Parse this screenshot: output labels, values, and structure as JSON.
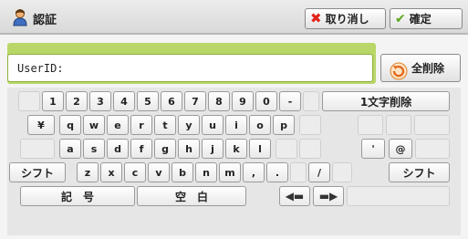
{
  "header": {
    "title": "認証",
    "cancel_label": "取り消し",
    "confirm_label": "確定"
  },
  "input": {
    "value": "UserID:"
  },
  "clear_all_label": "全削除",
  "keys": {
    "r1": [
      "1",
      "2",
      "3",
      "4",
      "5",
      "6",
      "7",
      "8",
      "9",
      "0",
      "-"
    ],
    "delete_one": "1文字削除",
    "r2": [
      "¥",
      "q",
      "w",
      "e",
      "r",
      "t",
      "y",
      "u",
      "i",
      "o",
      "p"
    ],
    "r3": [
      "a",
      "s",
      "d",
      "f",
      "g",
      "h",
      "j",
      "k",
      "l",
      "'",
      "@"
    ],
    "shift": "シフト",
    "r4": [
      "z",
      "x",
      "c",
      "v",
      "b",
      "n",
      "m",
      ",",
      ".",
      "/"
    ],
    "symbols": "記　号",
    "space": "空　白",
    "left_arrow": "◀▬",
    "right_arrow": "▬▶"
  },
  "colors": {
    "input_panel": "#b9d768",
    "cancel_accent": "#e0231a",
    "confirm_accent": "#5ca71c"
  }
}
